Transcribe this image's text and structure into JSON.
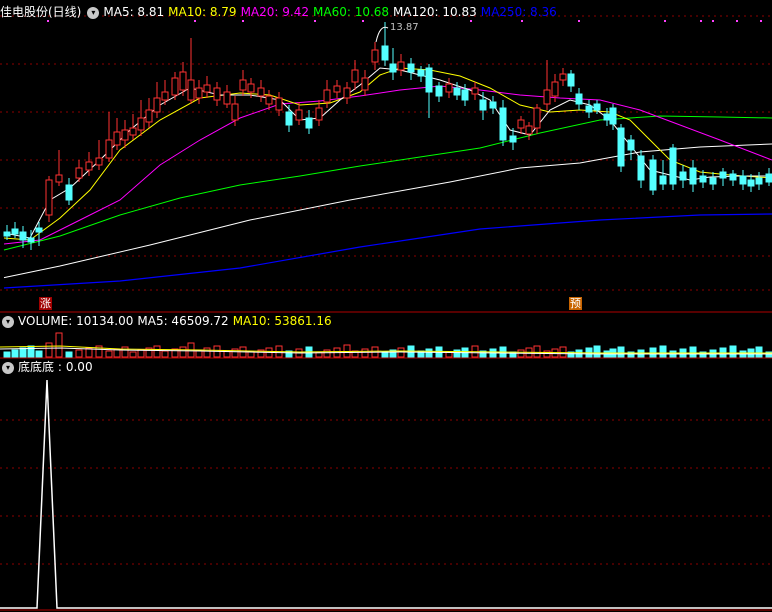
{
  "stock": {
    "title": "佳电股份(日线)"
  },
  "main_indicators": [
    {
      "label": "MA5:",
      "value": "8.81",
      "color": "#ffffff"
    },
    {
      "label": "MA10:",
      "value": "8.79",
      "color": "#ffff00"
    },
    {
      "label": "MA20:",
      "value": "9.42",
      "color": "#ff00ff"
    },
    {
      "label": "MA60:",
      "value": "10.68",
      "color": "#00ff00"
    },
    {
      "label": "MA120:",
      "value": "10.83",
      "color": "#ffffff"
    },
    {
      "label": "MA250:",
      "value": "8.36",
      "color": "#0000ff"
    }
  ],
  "high_label": "13.87",
  "signals": [
    {
      "text": "涨",
      "bg": "#a00000"
    },
    {
      "text": "预",
      "bg": "#c86400"
    }
  ],
  "volume_indicators": [
    {
      "label": "VOLUME:",
      "value": "10134.00",
      "color": "#ffffff"
    },
    {
      "label": "MA5:",
      "value": "46509.72",
      "color": "#ffffff"
    },
    {
      "label": "MA10:",
      "value": "53861.16",
      "color": "#ffff00"
    }
  ],
  "bottom_indicator": {
    "label": "底底底 :",
    "value": "0.00"
  },
  "icons": {
    "collapse": "chevron-down-icon"
  },
  "colors": {
    "up": "#ff3232",
    "down": "#54ffff",
    "grid": "#8b0000",
    "ma5": "#ffffff",
    "ma10": "#ffff00",
    "ma20": "#ff00ff",
    "ma60": "#00ff00",
    "ma120": "#ffffff",
    "ma250": "#0000ff"
  }
}
